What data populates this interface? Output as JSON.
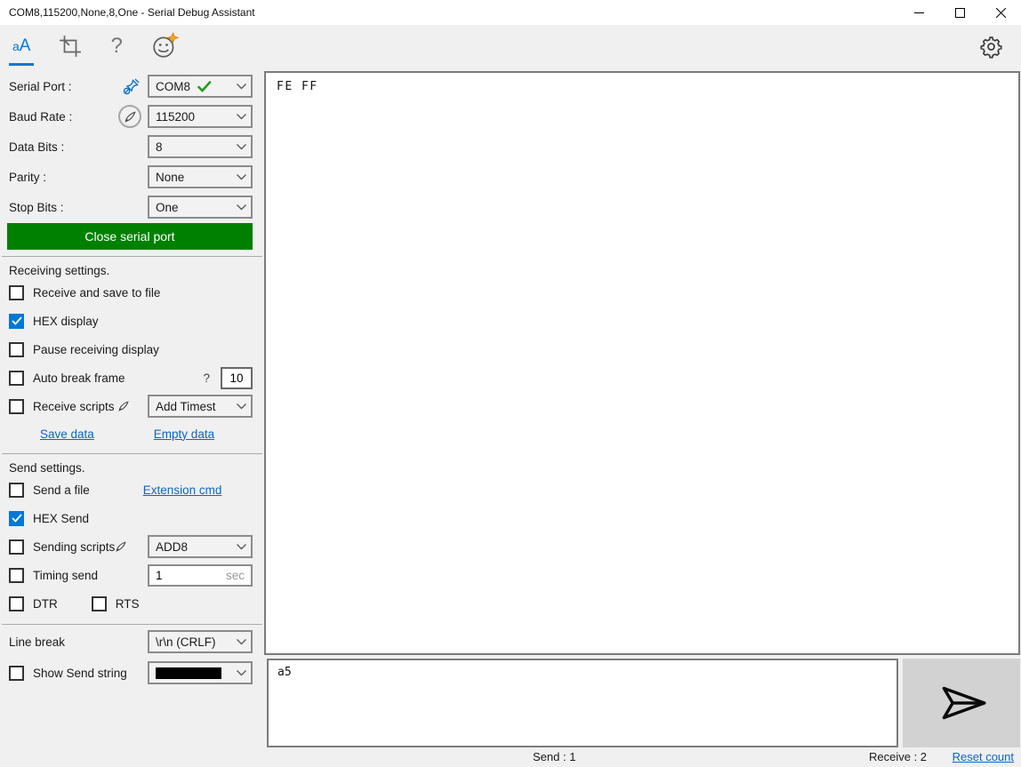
{
  "titlebar": {
    "title": "COM8,115200,None,8,One - Serial Debug Assistant"
  },
  "toolbar": {
    "font_button": "aA",
    "help_button": "?"
  },
  "port_settings": {
    "serial_port_label": "Serial Port :",
    "serial_port_value": "COM8",
    "baud_rate_label": "Baud Rate :",
    "baud_rate_value": "115200",
    "data_bits_label": "Data Bits :",
    "data_bits_value": "8",
    "parity_label": "Parity :",
    "parity_value": "None",
    "stop_bits_label": "Stop Bits :",
    "stop_bits_value": "One",
    "close_button_label": "Close serial port"
  },
  "receiving_settings": {
    "section_title": "Receiving settings.",
    "receive_save_label": "Receive and save to file",
    "receive_save_checked": false,
    "hex_display_label": "HEX display",
    "hex_display_checked": true,
    "pause_label": "Pause receiving display",
    "pause_checked": false,
    "auto_break_label": "Auto break frame",
    "auto_break_help": "?",
    "auto_break_value": "10",
    "auto_break_checked": false,
    "receive_scripts_label": "Receive scripts",
    "receive_scripts_checked": false,
    "receive_scripts_value": "Add Timest",
    "save_data_link": "Save data",
    "empty_data_link": "Empty data"
  },
  "send_settings": {
    "section_title": "Send settings.",
    "send_file_label": "Send a file",
    "send_file_checked": false,
    "extension_cmd_link": "Extension cmd",
    "hex_send_label": "HEX Send",
    "hex_send_checked": true,
    "sending_scripts_label": "Sending scripts",
    "sending_scripts_checked": false,
    "sending_scripts_value": "ADD8",
    "timing_send_label": "Timing send",
    "timing_send_checked": false,
    "timing_value": "1",
    "timing_unit": "sec",
    "dtr_label": "DTR",
    "dtr_checked": false,
    "rts_label": "RTS",
    "rts_checked": false,
    "line_break_label": "Line break",
    "line_break_value": "\\r\\n (CRLF)",
    "show_send_string_label": "Show Send string",
    "show_send_string_checked": false,
    "send_string_color": "#000000"
  },
  "receive_area": {
    "content": "FE FF"
  },
  "send_area": {
    "text": "a5"
  },
  "statusbar": {
    "send_count": "Send : 1",
    "receive_count": "Receive : 2",
    "reset_link": "Reset count"
  },
  "colors": {
    "accent_blue": "#0078d7",
    "close_port_green": "#008000",
    "link_blue": "#0c64c8",
    "checkmark_green": "#1f9d1f"
  }
}
